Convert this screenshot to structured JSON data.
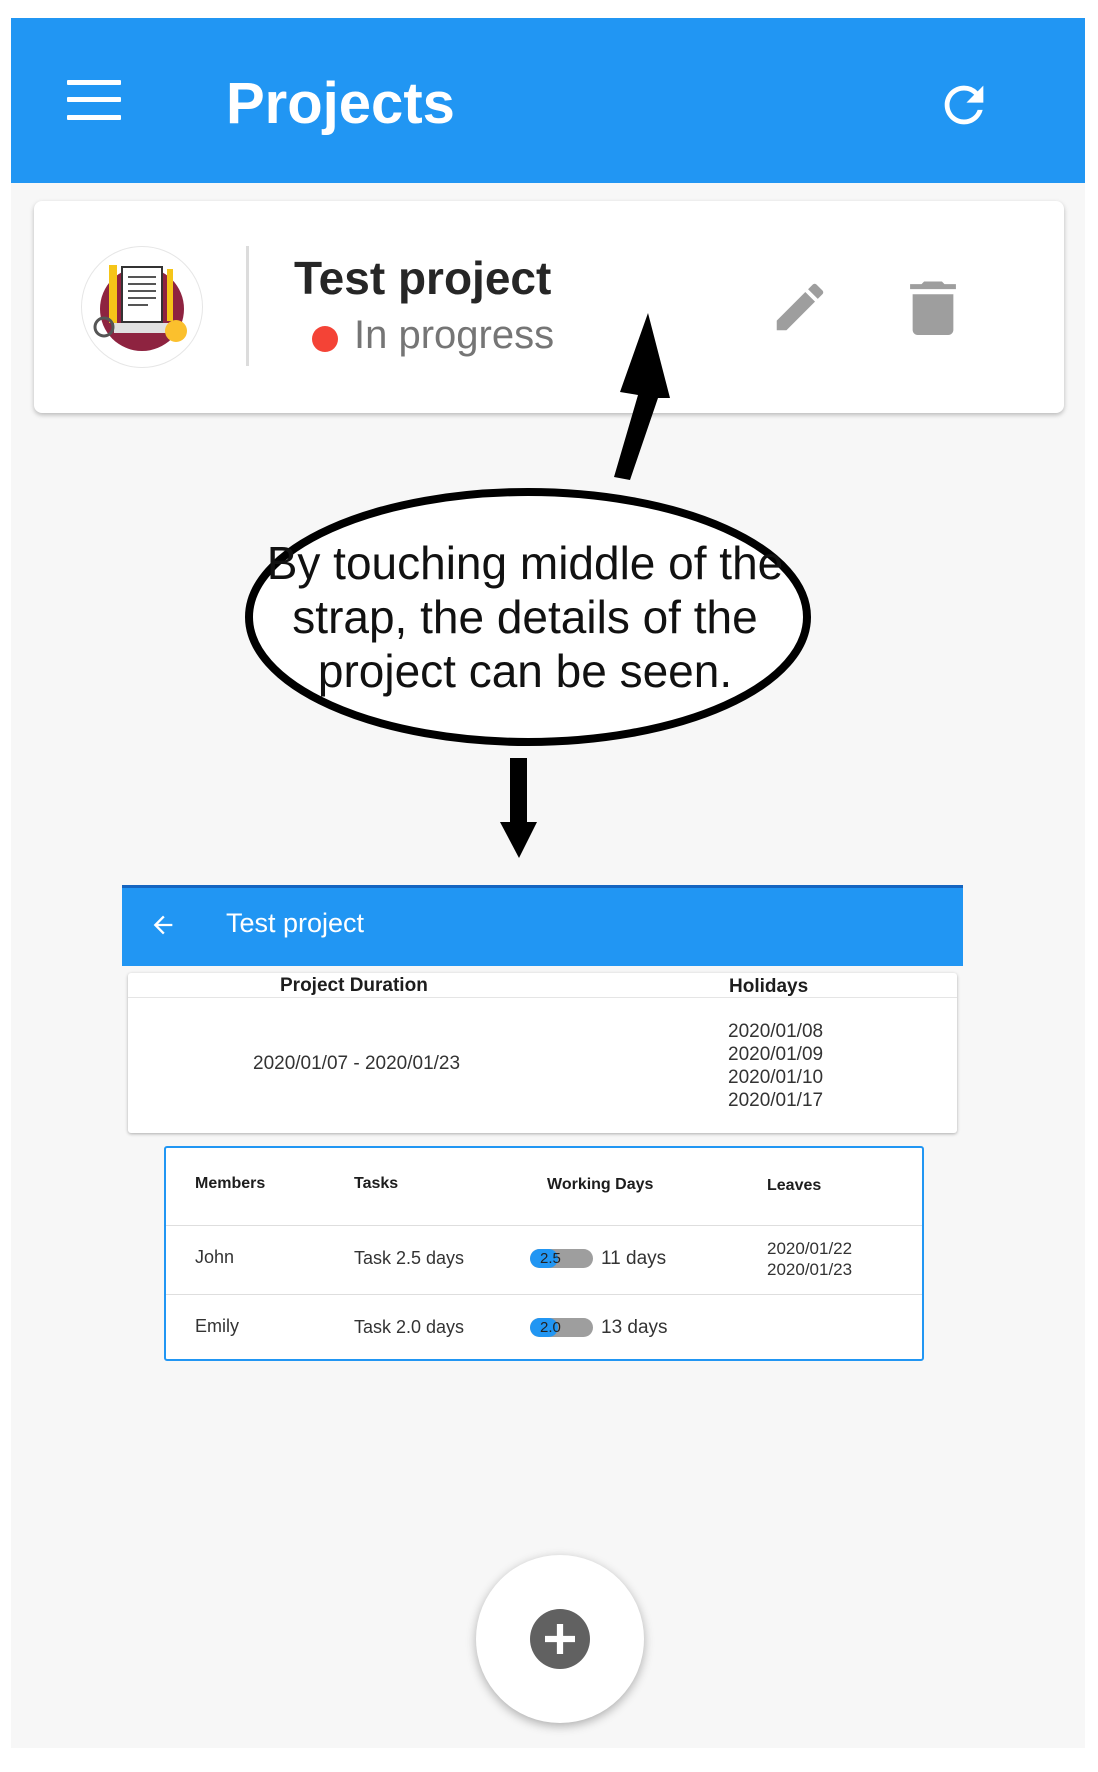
{
  "appbar": {
    "title": "Projects",
    "menu_icon": "menu-icon",
    "refresh_icon": "refresh-icon",
    "color": "#2196f3"
  },
  "project_card": {
    "name": "Test project",
    "status": "In progress",
    "status_color": "#f44336",
    "avatar_icon": "project-illustration",
    "edit_icon": "pencil-icon",
    "delete_icon": "trash-icon"
  },
  "annotation": {
    "line1": "By touching middle of the",
    "line2": "strap, the details of the",
    "line3": "project can be seen."
  },
  "detail": {
    "title": "Test project",
    "back_icon": "arrow-left-icon",
    "duration_header": "Project Duration",
    "holidays_header": "Holidays",
    "duration_value": "2020/01/07 - 2020/01/23",
    "holidays": [
      "2020/01/08",
      "2020/01/09",
      "2020/01/10",
      "2020/01/17"
    ]
  },
  "members_table": {
    "headers": [
      "Members",
      "Tasks",
      "Working Days",
      "Leaves"
    ],
    "rows": [
      {
        "member": "John",
        "task": "Task 2.5 days",
        "progress_label": "2.5",
        "progress": 0.45,
        "working_days": "11 days",
        "leaves": [
          "2020/01/22",
          "2020/01/23"
        ]
      },
      {
        "member": "Emily",
        "task": "Task 2.0 days",
        "progress_label": "2.0",
        "progress": 0.45,
        "working_days": "13 days",
        "leaves": []
      }
    ]
  },
  "fab": {
    "icon": "add-circle-icon"
  }
}
